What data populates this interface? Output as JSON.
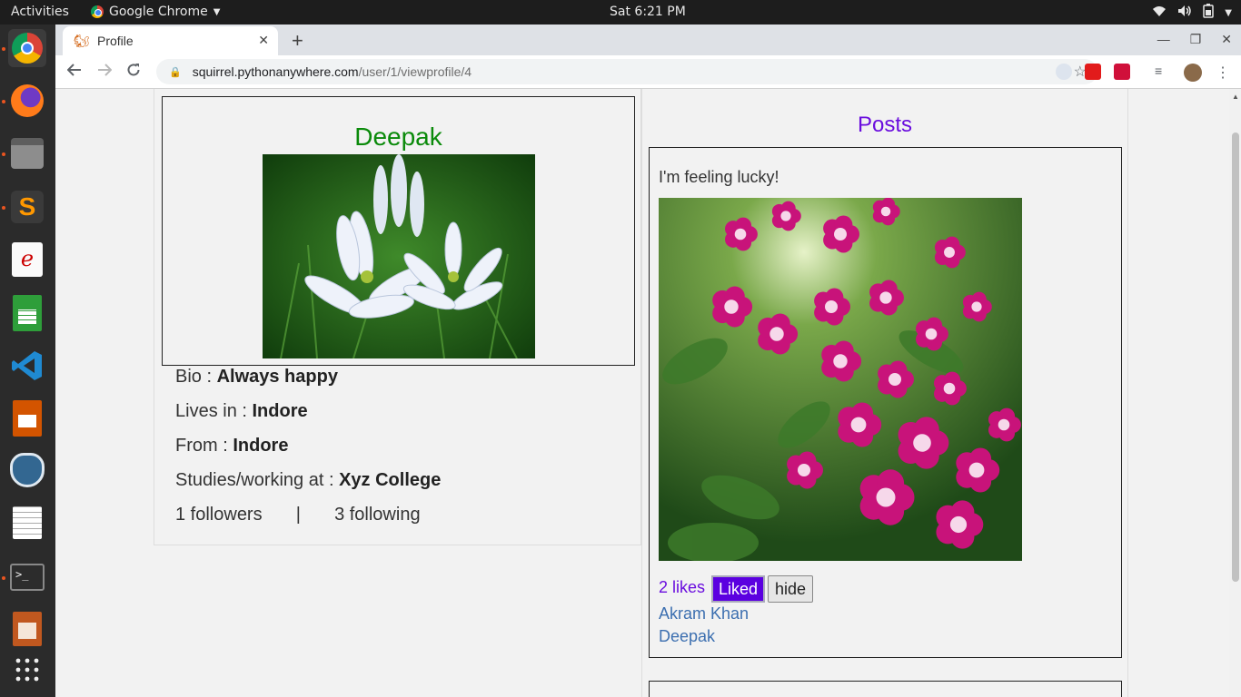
{
  "topbar": {
    "activities": "Activities",
    "app_name": "Google Chrome",
    "clock": "Sat  6:21 PM"
  },
  "dock": {
    "items": [
      "chrome-icon",
      "firefox-icon",
      "files-icon",
      "sublime-text-icon",
      "evince-icon",
      "spreadsheet-icon",
      "vscode-icon",
      "presentation-icon",
      "pgadmin-icon",
      "text-editor-icon",
      "terminal-icon",
      "document-viewer-icon",
      "app-grid-icon"
    ]
  },
  "browser": {
    "tab_title": "Profile",
    "url_host": "squirrel.pythonanywhere.com",
    "url_path": "/user/1/viewprofile/4"
  },
  "profile": {
    "name": "Deepak",
    "bio_label": "Bio : ",
    "bio_value": "Always happy",
    "lives_label": "Lives in : ",
    "lives_value": "Indore",
    "from_label": "From : ",
    "from_value": "Indore",
    "studies_label": "Studies/working at : ",
    "studies_value": "Xyz College",
    "followers": "1 followers",
    "separator": "|",
    "following": "3 following"
  },
  "posts": {
    "heading": "Posts",
    "items": [
      {
        "text": "I'm feeling lucky!",
        "likes": "2 likes",
        "liked_label": "Liked",
        "hide_label": "hide",
        "likers": [
          "Akram Khan",
          "Deepak"
        ]
      }
    ]
  },
  "colors": {
    "name_green": "#0a8a0a",
    "accent_purple": "#6a0dde",
    "liked_bg": "#5b00e0",
    "link_blue": "#3c6fb0"
  }
}
